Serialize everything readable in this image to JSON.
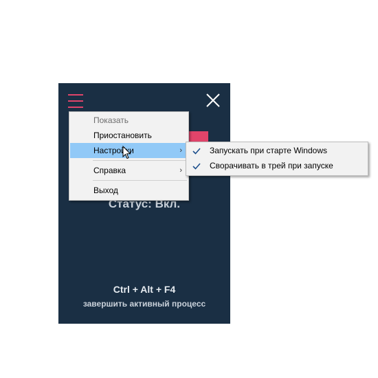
{
  "app": {
    "status": "Статус: Вкл.",
    "hotkey": "Ctrl + Alt + F4",
    "hotkey_desc": "завершить активный процесс",
    "accent_color": "#e0446a",
    "background_color": "#1a2f44"
  },
  "menu": {
    "items": [
      {
        "label": "Показать",
        "state": "disabled"
      },
      {
        "label": "Приостановить",
        "state": "normal"
      },
      {
        "label": "Настройки",
        "state": "highlighted",
        "has_submenu": true
      },
      {
        "label": "Справка",
        "state": "normal",
        "has_submenu": true
      },
      {
        "label": "Выход",
        "state": "normal"
      }
    ],
    "arrow": "›"
  },
  "submenu": {
    "items": [
      {
        "label": "Запускать при старте Windows",
        "checked": true
      },
      {
        "label": "Сворачивать в трей при запуске",
        "checked": true
      }
    ]
  },
  "icons": {
    "menu": "hamburger-icon",
    "close": "close-icon",
    "check": "checkmark-icon",
    "cursor": "mouse-pointer-icon"
  }
}
